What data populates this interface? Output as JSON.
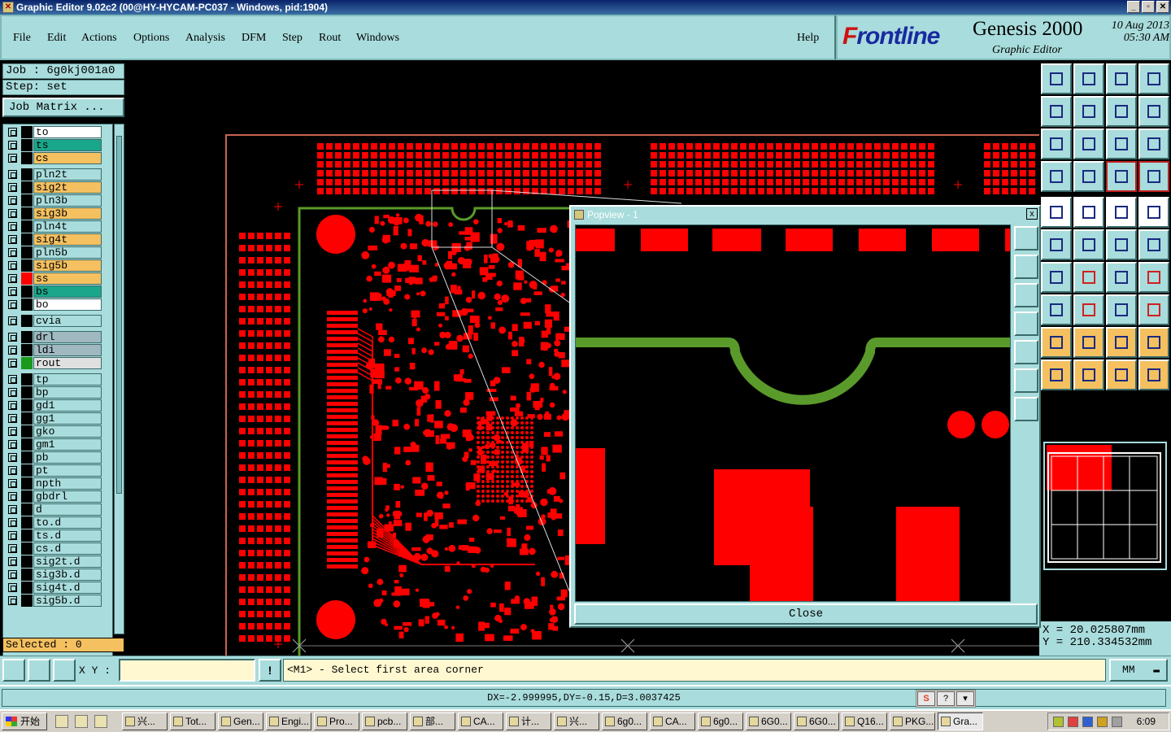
{
  "window": {
    "title": "Graphic Editor 9.02c2 (00@HY-HYCAM-PC037 - Windows, pid:1904)",
    "controls": [
      "_",
      "▫",
      "✕"
    ]
  },
  "menu": {
    "items": [
      "File",
      "Edit",
      "Actions",
      "Options",
      "Analysis",
      "DFM",
      "Step",
      "Rout",
      "Windows"
    ],
    "help": "Help"
  },
  "brand": {
    "logo_f": "F",
    "logo_rest": "rontline",
    "product": "Genesis 2000",
    "subtitle": "Graphic Editor",
    "date": "10 Aug 2013",
    "time": "05:30 AM"
  },
  "job": {
    "job_line": "Job : 6g0kj001a0",
    "step_line": "Step: set",
    "matrix_button": "Job Matrix ..."
  },
  "layers": [
    {
      "name": "to",
      "color": "#ffffff",
      "swatch": "#000000"
    },
    {
      "name": "ts",
      "color": "#1aa68a",
      "swatch": "#000000"
    },
    {
      "name": "cs",
      "color": "#f5c060",
      "swatch": "#000000"
    },
    {
      "name": "pln2t",
      "color": "#a9dcdc",
      "swatch": "#000000"
    },
    {
      "name": "sig2t",
      "color": "#f5c060",
      "swatch": "#000000"
    },
    {
      "name": "pln3b",
      "color": "#a9dcdc",
      "swatch": "#000000"
    },
    {
      "name": "sig3b",
      "color": "#f5c060",
      "swatch": "#000000"
    },
    {
      "name": "pln4t",
      "color": "#a9dcdc",
      "swatch": "#000000"
    },
    {
      "name": "sig4t",
      "color": "#f5c060",
      "swatch": "#000000"
    },
    {
      "name": "pln5b",
      "color": "#a9dcdc",
      "swatch": "#000000"
    },
    {
      "name": "sig5b",
      "color": "#f5c060",
      "swatch": "#000000"
    },
    {
      "name": "ss",
      "color": "#f5c060",
      "swatch": "#ff0000"
    },
    {
      "name": "bs",
      "color": "#1aa68a",
      "swatch": "#000000"
    },
    {
      "name": "bo",
      "color": "#ffffff",
      "swatch": "#000000"
    },
    {
      "name": "cvia",
      "color": "#a9dcdc",
      "swatch": "#000000"
    },
    {
      "name": "drl",
      "color": "#a0b8c0",
      "swatch": "#000000"
    },
    {
      "name": "ldi",
      "color": "#a0b8c0",
      "swatch": "#000000"
    },
    {
      "name": "rout",
      "color": "#e0e0e0",
      "swatch": "#1a9a1a"
    },
    {
      "name": "tp",
      "color": "#a9dcdc",
      "swatch": "#000000"
    },
    {
      "name": "bp",
      "color": "#a9dcdc",
      "swatch": "#000000"
    },
    {
      "name": "gd1",
      "color": "#a9dcdc",
      "swatch": "#000000"
    },
    {
      "name": "gg1",
      "color": "#a9dcdc",
      "swatch": "#000000"
    },
    {
      "name": "gko",
      "color": "#a9dcdc",
      "swatch": "#000000"
    },
    {
      "name": "gm1",
      "color": "#a9dcdc",
      "swatch": "#000000"
    },
    {
      "name": "pb",
      "color": "#a9dcdc",
      "swatch": "#000000"
    },
    {
      "name": "pt",
      "color": "#a9dcdc",
      "swatch": "#000000"
    },
    {
      "name": "npth",
      "color": "#a9dcdc",
      "swatch": "#000000"
    },
    {
      "name": "gbdrl",
      "color": "#a9dcdc",
      "swatch": "#000000"
    },
    {
      "name": "d",
      "color": "#a9dcdc",
      "swatch": "#000000"
    },
    {
      "name": "to.d",
      "color": "#a9dcdc",
      "swatch": "#000000"
    },
    {
      "name": "ts.d",
      "color": "#a9dcdc",
      "swatch": "#000000"
    },
    {
      "name": "cs.d",
      "color": "#a9dcdc",
      "swatch": "#000000"
    },
    {
      "name": "sig2t.d",
      "color": "#a9dcdc",
      "swatch": "#000000"
    },
    {
      "name": "sig3b.d",
      "color": "#a9dcdc",
      "swatch": "#000000"
    },
    {
      "name": "sig4t.d",
      "color": "#a9dcdc",
      "swatch": "#000000"
    },
    {
      "name": "sig5b.d",
      "color": "#a9dcdc",
      "swatch": "#000000"
    }
  ],
  "selected": "Selected : 0",
  "popview": {
    "title": "Popview - 1",
    "close_x": "x",
    "close_button": "Close"
  },
  "coords": {
    "x_line": "X = 20.025807mm",
    "y_line": "Y = 210.334532mm"
  },
  "command": {
    "xy_label": "X Y :",
    "xy_value": "",
    "info_icon": "!",
    "message": "<M1> - Select first area corner",
    "units": "MM"
  },
  "status": {
    "text": "DX=-2.999995,DY=-0.15,D=3.0037425",
    "ime": [
      "S",
      "?",
      "▾"
    ]
  },
  "taskbar": {
    "start": "开始",
    "tasks": [
      "兴...",
      "Tot...",
      "Gen...",
      "Engi...",
      "Pro...",
      "pcb...",
      "部...",
      "CA...",
      "计...",
      "兴...",
      "6g0...",
      "CA...",
      "6g0...",
      "6G0...",
      "6G0...",
      "Q16...",
      "PKG...",
      "Gra..."
    ],
    "clock": "6:09"
  },
  "colors": {
    "panel": "#a9dcdc",
    "copper": "#ff0000",
    "outline": "#5a9a2a",
    "selected_bg": "#f5c060"
  }
}
